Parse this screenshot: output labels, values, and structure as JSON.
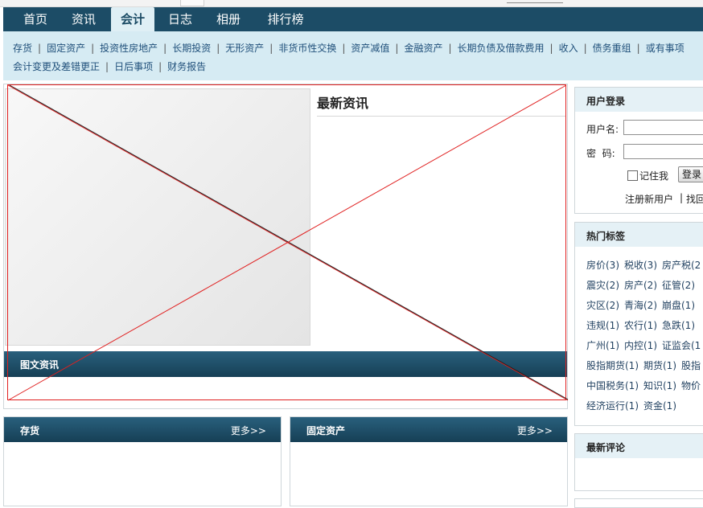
{
  "nav": {
    "items": [
      {
        "label": "首页",
        "active": false
      },
      {
        "label": "资讯",
        "active": false
      },
      {
        "label": "会计",
        "active": true
      },
      {
        "label": "日志",
        "active": false
      },
      {
        "label": "相册",
        "active": false
      },
      {
        "label": "排行榜",
        "active": false
      }
    ]
  },
  "subnav": {
    "row1": [
      "存货",
      "固定资产",
      "投资性房地产",
      "长期投资",
      "无形资产",
      "非货币性交换",
      "资产减值",
      "金融资产",
      "长期负债及借款费用",
      "收入",
      "债务重组",
      "或有事项"
    ],
    "row2": [
      "会计变更及差错更正",
      "日后事项",
      "财务报告"
    ]
  },
  "main": {
    "news_title": "最新资讯",
    "picture_news_label": "图文资讯"
  },
  "sections": [
    {
      "title": "存货",
      "more": "更多>>"
    },
    {
      "title": "固定资产",
      "more": "更多>>"
    }
  ],
  "login": {
    "title": "用户登录",
    "username_label": "用户名:",
    "password_label": "密  码:",
    "remember_label": "记住我",
    "login_button": "登录",
    "register_link": "注册新用户",
    "sep": "|",
    "find_link": "找回"
  },
  "tags": {
    "title": "热门标签",
    "rows": [
      [
        "房价(3)",
        "税收(3)",
        "房产税(2"
      ],
      [
        "震灾(2)",
        "房产(2)",
        "征管(2)"
      ],
      [
        "灾区(2)",
        "青海(2)",
        "崩盘(1)"
      ],
      [
        "违规(1)",
        "农行(1)",
        "急跌(1)"
      ],
      [
        "广州(1)",
        "内控(1)",
        "证监会(1"
      ],
      [
        "股指期货(1)",
        "期货(1)",
        "股指"
      ],
      [
        "中国税务(1)",
        "知识(1)",
        "物价"
      ],
      [
        "经济运行(1)",
        "资金(1)"
      ]
    ]
  },
  "comments": {
    "title": "最新评论"
  },
  "colors": {
    "nav_bg": "#1c4c66",
    "subnav_bg": "#d6ebf3",
    "bar_bg": "#1f5069",
    "cross": "#e02020"
  }
}
